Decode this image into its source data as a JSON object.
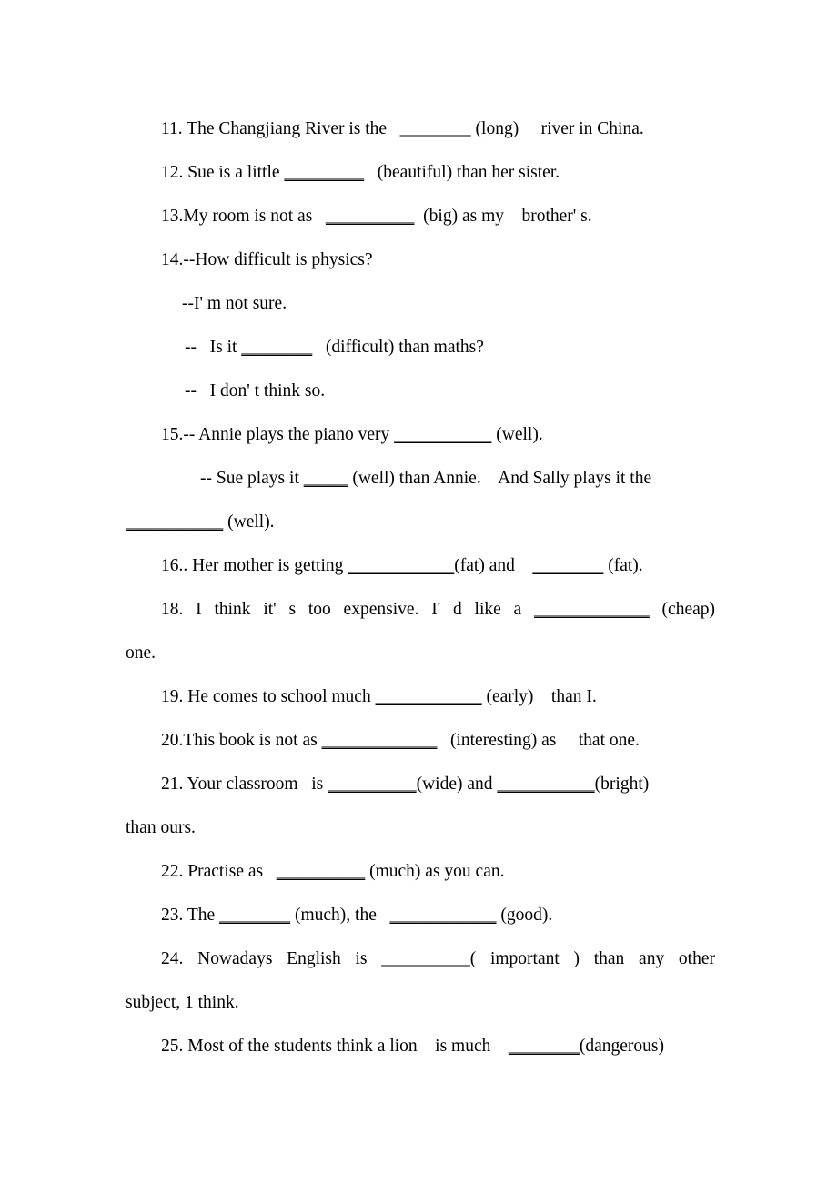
{
  "document": {
    "type": "grammar-worksheet",
    "description": "Fill-in-the-blank comparative and superlative adjective exercises",
    "page_background": "#ffffff",
    "text_color": "#000000",
    "blank_glyph": "underscore-run"
  },
  "exercises": [
    {
      "number": "11",
      "lines": [
        {
          "id": "l11",
          "indent": "item",
          "justified": false,
          "segments": [
            {
              "type": "text",
              "value": "11. The Changjiang River is the   "
            },
            {
              "type": "blank",
              "value": "________"
            },
            {
              "type": "text",
              "value": " (long)     river in China."
            }
          ]
        }
      ]
    },
    {
      "number": "12",
      "lines": [
        {
          "id": "l12",
          "indent": "item",
          "justified": false,
          "segments": [
            {
              "type": "text",
              "value": "12. Sue is a little "
            },
            {
              "type": "blank",
              "value": "_________"
            },
            {
              "type": "text",
              "value": "   (beautiful) than her sister."
            }
          ]
        }
      ]
    },
    {
      "number": "13",
      "lines": [
        {
          "id": "l13",
          "indent": "item",
          "justified": false,
          "segments": [
            {
              "type": "text",
              "value": "13.My room is not as   "
            },
            {
              "type": "blank",
              "value": "__________"
            },
            {
              "type": "text",
              "value": "  (big) as my    brother' s."
            }
          ]
        }
      ]
    },
    {
      "number": "14",
      "lines": [
        {
          "id": "l14a",
          "indent": "item",
          "justified": false,
          "segments": [
            {
              "type": "text",
              "value": "14.--How difficult is physics?"
            }
          ]
        },
        {
          "id": "l14b",
          "indent": "dash-a",
          "justified": false,
          "segments": [
            {
              "type": "text",
              "value": "--I' m not sure."
            }
          ]
        },
        {
          "id": "l14c",
          "indent": "dash-b",
          "justified": false,
          "segments": [
            {
              "type": "text",
              "value": "--   Is it "
            },
            {
              "type": "blank",
              "value": "________"
            },
            {
              "type": "text",
              "value": "   (difficult) than maths?"
            }
          ]
        },
        {
          "id": "l14d",
          "indent": "dash-b",
          "justified": false,
          "segments": [
            {
              "type": "text",
              "value": "--   I don' t think so."
            }
          ]
        }
      ]
    },
    {
      "number": "15",
      "lines": [
        {
          "id": "l15a",
          "indent": "item",
          "justified": false,
          "segments": [
            {
              "type": "text",
              "value": "15.-- Annie plays the piano very "
            },
            {
              "type": "blank",
              "value": "___________"
            },
            {
              "type": "text",
              "value": " (well)."
            }
          ]
        },
        {
          "id": "l15b",
          "indent": "sub",
          "justified": false,
          "segments": [
            {
              "type": "text",
              "value": "-- Sue plays it "
            },
            {
              "type": "blank",
              "value": "_____"
            },
            {
              "type": "text",
              "value": " (well) than Annie.    And Sally plays it the"
            }
          ]
        },
        {
          "id": "l15c",
          "indent": "none",
          "justified": false,
          "segments": [
            {
              "type": "blank",
              "value": "___________"
            },
            {
              "type": "text",
              "value": " (well)."
            }
          ]
        }
      ]
    },
    {
      "number": "16",
      "lines": [
        {
          "id": "l16",
          "indent": "item",
          "justified": false,
          "segments": [
            {
              "type": "text",
              "value": "16.. Her mother is getting "
            },
            {
              "type": "blank",
              "value": "____________"
            },
            {
              "type": "text",
              "value": "(fat) and    "
            },
            {
              "type": "blank",
              "value": "________"
            },
            {
              "type": "text",
              "value": " (fat)."
            }
          ]
        }
      ]
    },
    {
      "number": "18",
      "lines": [
        {
          "id": "l18a",
          "indent": "item",
          "justified": true,
          "segments": [
            {
              "type": "text",
              "value": "18. I think it' s too expensive. I' d like a "
            },
            {
              "type": "blank",
              "value": "_____________"
            },
            {
              "type": "text",
              "value": " (cheap)"
            }
          ]
        },
        {
          "id": "l18b",
          "indent": "none",
          "justified": false,
          "segments": [
            {
              "type": "text",
              "value": "one."
            }
          ]
        }
      ]
    },
    {
      "number": "19",
      "lines": [
        {
          "id": "l19",
          "indent": "item",
          "justified": false,
          "segments": [
            {
              "type": "text",
              "value": "19. He comes to school much "
            },
            {
              "type": "blank",
              "value": "____________"
            },
            {
              "type": "text",
              "value": " (early)    than I."
            }
          ]
        }
      ]
    },
    {
      "number": "20",
      "lines": [
        {
          "id": "l20",
          "indent": "item",
          "justified": false,
          "segments": [
            {
              "type": "text",
              "value": "20.This book is not as "
            },
            {
              "type": "blank",
              "value": "_____________"
            },
            {
              "type": "text",
              "value": "   (interesting) as     that one."
            }
          ]
        }
      ]
    },
    {
      "number": "21",
      "lines": [
        {
          "id": "l21a",
          "indent": "item",
          "justified": false,
          "segments": [
            {
              "type": "text",
              "value": "21. Your classroom   is "
            },
            {
              "type": "blank",
              "value": "__________"
            },
            {
              "type": "text",
              "value": "(wide) and "
            },
            {
              "type": "blank",
              "value": "___________"
            },
            {
              "type": "text",
              "value": "(bright)"
            }
          ]
        },
        {
          "id": "l21b",
          "indent": "none",
          "justified": false,
          "segments": [
            {
              "type": "text",
              "value": "than ours."
            }
          ]
        }
      ]
    },
    {
      "number": "22",
      "lines": [
        {
          "id": "l22",
          "indent": "item",
          "justified": false,
          "segments": [
            {
              "type": "text",
              "value": "22. Practise as   "
            },
            {
              "type": "blank",
              "value": "__________"
            },
            {
              "type": "text",
              "value": " (much) as you can."
            }
          ]
        }
      ]
    },
    {
      "number": "23",
      "lines": [
        {
          "id": "l23",
          "indent": "item",
          "justified": false,
          "segments": [
            {
              "type": "text",
              "value": "23. The "
            },
            {
              "type": "blank",
              "value": "________"
            },
            {
              "type": "text",
              "value": " (much), the   "
            },
            {
              "type": "blank",
              "value": "____________"
            },
            {
              "type": "text",
              "value": " (good)."
            }
          ]
        }
      ]
    },
    {
      "number": "24",
      "lines": [
        {
          "id": "l24a",
          "indent": "item",
          "justified": true,
          "segments": [
            {
              "type": "text",
              "value": "24. Nowadays English is "
            },
            {
              "type": "blank",
              "value": "__________"
            },
            {
              "type": "text",
              "value": "( important ) than any other"
            }
          ]
        },
        {
          "id": "l24b",
          "indent": "none",
          "justified": false,
          "segments": [
            {
              "type": "text",
              "value": "subject, 1 think."
            }
          ]
        }
      ]
    },
    {
      "number": "25",
      "lines": [
        {
          "id": "l25",
          "indent": "item",
          "justified": false,
          "segments": [
            {
              "type": "text",
              "value": "25. Most of the students think a lion    is much    "
            },
            {
              "type": "blank",
              "value": "________"
            },
            {
              "type": "text",
              "value": "(dangerous)"
            }
          ]
        }
      ]
    }
  ]
}
